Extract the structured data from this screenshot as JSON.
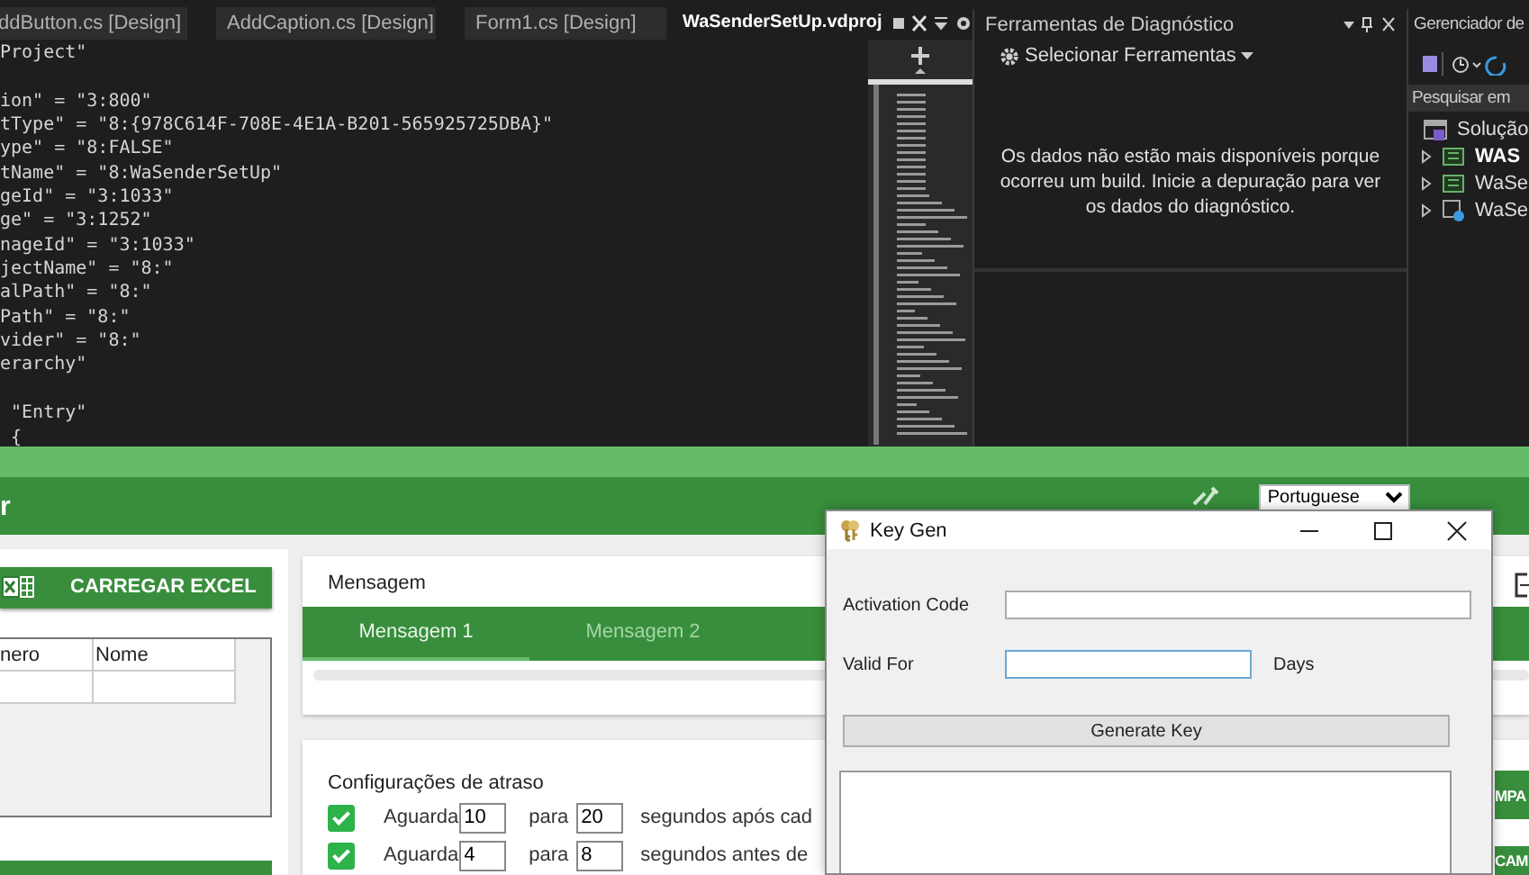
{
  "ide": {
    "tabs": [
      {
        "label": "ddButton.cs [Design]",
        "selected": false
      },
      {
        "label": "AddCaption.cs [Design]",
        "selected": false
      },
      {
        "label": "Form1.cs [Design]",
        "selected": false
      },
      {
        "label": "WaSenderSetUp.vdproj",
        "selected": true
      }
    ],
    "code_blocks": [
      [
        "Project\""
      ],
      [
        "ion\" = \"3:800\"",
        "tType\" = \"8:{978C614F-708E-4E1A-B201-565925725DBA}\"",
        "ype\" = \"8:FALSE\"",
        "tName\" = \"8:WaSenderSetUp\"",
        "geId\" = \"3:1033\"",
        "ge\" = \"3:1252\"",
        "nageId\" = \"3:1033\"",
        "jectName\" = \"8:\"",
        "alPath\" = \"8:\"",
        "Path\" = \"8:\"",
        "vider\" = \"8:\"",
        "erarchy\""
      ],
      [
        " \"Entry\"",
        " {"
      ]
    ],
    "diagnostics": {
      "title": "Ferramentas de Diagnóstico",
      "tool_selector": "Selecionar Ferramentas",
      "message": "Os dados não estão mais disponíveis porque ocorreu um build. Inicie a depuração para ver os dados do diagnóstico."
    },
    "solution_explorer": {
      "title": "Gerenciador de",
      "search_placeholder": "Pesquisar em",
      "items": [
        {
          "label": "Solução",
          "kind": "solution",
          "bold": false
        },
        {
          "label": "WAS",
          "kind": "project",
          "bold": true
        },
        {
          "label": "WaSe",
          "kind": "project",
          "bold": false
        },
        {
          "label": "WaSe",
          "kind": "setup",
          "bold": false
        }
      ]
    }
  },
  "app": {
    "title": "r",
    "language": "Portuguese",
    "excel_button": "CARREGAR EXCEL",
    "contacts_table": {
      "columns": [
        "nero",
        "Nome"
      ]
    },
    "message_card": {
      "title": "Mensagem",
      "tabs": [
        {
          "label": "Mensagem 1",
          "selected": true
        },
        {
          "label": "Mensagem 2",
          "selected": false
        }
      ]
    },
    "delay_card": {
      "title": "Configurações de atraso",
      "rows": [
        {
          "checked": true,
          "label": "Aguarda",
          "from": "10",
          "to_label": "para",
          "to": "20",
          "suffix": "segundos após cad"
        },
        {
          "checked": true,
          "label": "Aguarda",
          "from": "4",
          "to_label": "para",
          "to": "8",
          "suffix": "segundos antes de"
        }
      ]
    },
    "side_buttons": [
      "MPA",
      "CAM"
    ]
  },
  "key_gen": {
    "title": "Key Gen",
    "fields": [
      {
        "label": "Activation Code",
        "kind": "wide"
      },
      {
        "label": "Valid For",
        "kind": "short",
        "unit": "Days"
      }
    ],
    "button": "Generate Key"
  }
}
